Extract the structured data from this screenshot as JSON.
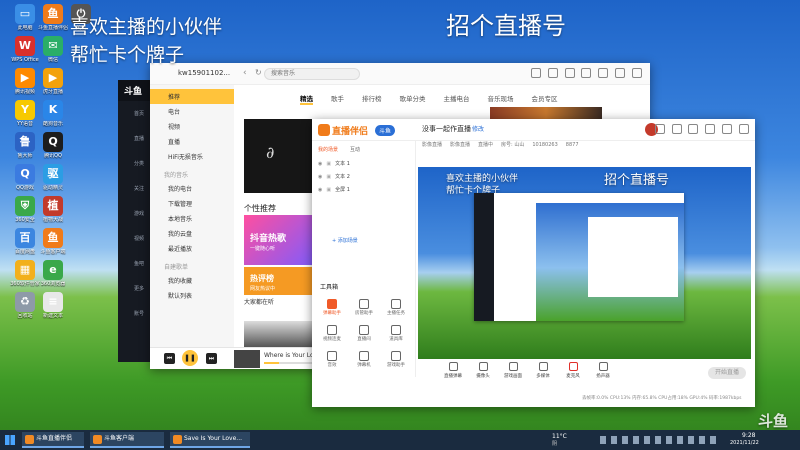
{
  "overlay": {
    "line1": "喜欢主播的小伙伴",
    "line2": "帮忙卡个牌子",
    "headline": "招个直播号",
    "watermark": "斗鱼"
  },
  "desktop_icons": [
    {
      "label": "此电脑",
      "color": "#3a8ee6",
      "glyph": "▭"
    },
    {
      "label": "斗鱼直播伴侣",
      "color": "#f07b1a",
      "glyph": "鱼"
    },
    {
      "label": "关机",
      "color": "#555555",
      "glyph": "⏻"
    },
    {
      "label": "WPS Office",
      "color": "#d9302c",
      "glyph": "W"
    },
    {
      "label": "微信",
      "color": "#2aae67",
      "glyph": "✉"
    },
    {
      "label": "腾讯视频",
      "color": "#ff8a00",
      "glyph": "▶"
    },
    {
      "label": "虎牙直播",
      "color": "#f3a20b",
      "glyph": "▶"
    },
    {
      "label": "YY语音",
      "color": "#f7c900",
      "glyph": "Y"
    },
    {
      "label": "酷狗音乐",
      "color": "#2a86e8",
      "glyph": "K"
    },
    {
      "label": "鲁大师",
      "color": "#2c63c4",
      "glyph": "鲁"
    },
    {
      "label": "腾讯QQ",
      "color": "#1d1d1d",
      "glyph": "Q"
    },
    {
      "label": "QQ游戏",
      "color": "#3b7be0",
      "glyph": "Q"
    },
    {
      "label": "驱动精灵",
      "color": "#2b9de4",
      "glyph": "驱"
    },
    {
      "label": "360安全",
      "color": "#3aa84a",
      "glyph": "⛨"
    },
    {
      "label": "植物大战",
      "color": "#c23a2b",
      "glyph": "植"
    },
    {
      "label": "百度网盘",
      "color": "#3b86e0",
      "glyph": "百"
    },
    {
      "label": "斗鱼客户端",
      "color": "#f07b1a",
      "glyph": "鱼"
    },
    {
      "label": "360软件管家",
      "color": "#f2b01c",
      "glyph": "▦"
    },
    {
      "label": "360浏览器",
      "color": "#3aa84a",
      "glyph": "e"
    },
    {
      "label": "回收站",
      "color": "#8e9aa8",
      "glyph": "♻"
    },
    {
      "label": "新建文本",
      "color": "#e8e8e8",
      "glyph": "≡"
    }
  ],
  "music_app": {
    "title_user": "kw15901102...",
    "search_placeholder": "搜索音乐",
    "sidebar_items": [
      "推荐",
      "电台",
      "视频",
      "直播",
      "HiFi无损音乐"
    ],
    "sidebar_group2_title": "我的音乐",
    "sidebar_group2": [
      "我的电台",
      "下载管理",
      "本地音乐",
      "我的云盘",
      "最近播放"
    ],
    "sidebar_group3_title": "自建歌单",
    "sidebar_group3": [
      "我的收藏",
      "默认列表"
    ],
    "tabs": [
      "精选",
      "歌手",
      "排行榜",
      "歌单分类",
      "主播电台",
      "音乐现场",
      "会员专区"
    ],
    "section_title": "个性推荐",
    "card1_title": "抖音热歌",
    "card1_sub": "一键随心听",
    "card2_title": "热评榜",
    "card2_sub": "网友热议中",
    "card_caption": "大家都在听",
    "now_playing": "Where is Your Lo",
    "progress": 0.3
  },
  "left_dark_panel": {
    "logo": "斗鱼",
    "items": [
      "首页",
      "直播",
      "分类",
      "关注",
      "游戏",
      "视频",
      "鱼吧",
      "更多",
      "账号"
    ]
  },
  "obs_app": {
    "brand": "直播伴侣",
    "tag": "斗鱼",
    "room_title": "没事一起作直播",
    "room_edit": "修改",
    "info": [
      "影像直播",
      "影像直播",
      "直播中",
      "房号: 山山",
      "10180263",
      "8877"
    ],
    "scene_tabs": [
      "我的场景",
      "互动"
    ],
    "scenes": [
      "文本 1",
      "文本 2",
      "全屏 1"
    ],
    "add_scene_label": "+ 添加场景",
    "tools_title": "工具箱",
    "tools": [
      {
        "label": "弹幕助手",
        "color": "#f05a28"
      },
      {
        "label": "房管助手",
        "color": "#666666"
      },
      {
        "label": "主播任务",
        "color": "#666666"
      },
      {
        "label": "视频连麦",
        "color": "#666666"
      },
      {
        "label": "直播间",
        "color": "#666666"
      },
      {
        "label": "道具库",
        "color": "#666666"
      },
      {
        "label": "音效",
        "color": "#666666"
      },
      {
        "label": "弹幕机",
        "color": "#666666"
      },
      {
        "label": "游戏助手",
        "color": "#666666"
      }
    ],
    "bottom_tools": [
      "直播弹幕",
      "摄像头",
      "游戏画面",
      "多媒体",
      "麦克风",
      "扬声器"
    ],
    "start_label": "开始直播",
    "status_bar": "丢帧率:0.0%  CPU:13%  内存:65.8%  CPU占用:18%  GPU:4%  码率:1987kbps",
    "preview_headline": "招个直播号",
    "preview_line1": "喜欢主播的小伙伴",
    "preview_line2": "帮忙卡个牌子"
  },
  "taskbar": {
    "items": [
      {
        "label": "斗鱼直播伴侣"
      },
      {
        "label": "斗鱼客户端"
      },
      {
        "label": "Save Is Your Love..."
      }
    ],
    "weather": "11°C",
    "weather_text": "阴",
    "time": "9:28",
    "date": "2021/11/22"
  },
  "colors": {
    "orange": "#f07b1a",
    "music_gold": "#ffc33b",
    "obs_blue": "#2a6fd6"
  }
}
